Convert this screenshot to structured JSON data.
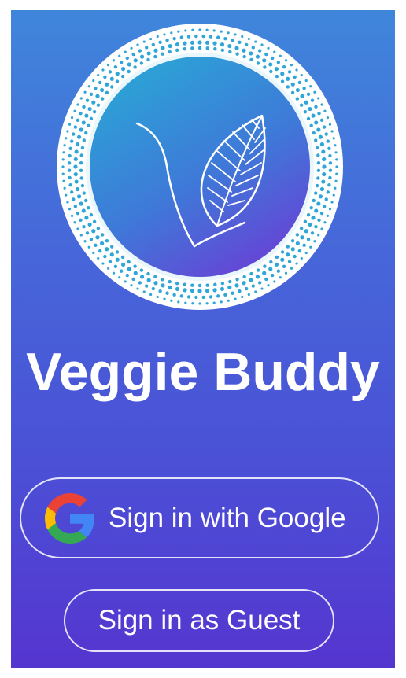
{
  "app": {
    "title": "Veggie Buddy"
  },
  "logo": {
    "icon": "veggie-leaf-v-logo"
  },
  "buttons": {
    "google_label": "Sign in with Google",
    "guest_label": "Sign in as Guest"
  },
  "icons": {
    "google": "google-g-icon"
  },
  "colors": {
    "background_top": "#3f86db",
    "background_bottom": "#5535cf",
    "logo_ring": "#ffffff",
    "logo_dots": "#2fa6d8",
    "logo_inner_top": "#2aa6d6",
    "logo_inner_bottom": "#6a3fd6",
    "text": "#ffffff",
    "google_blue": "#4285F4",
    "google_red": "#EA4335",
    "google_yellow": "#FBBC05",
    "google_green": "#34A853"
  }
}
